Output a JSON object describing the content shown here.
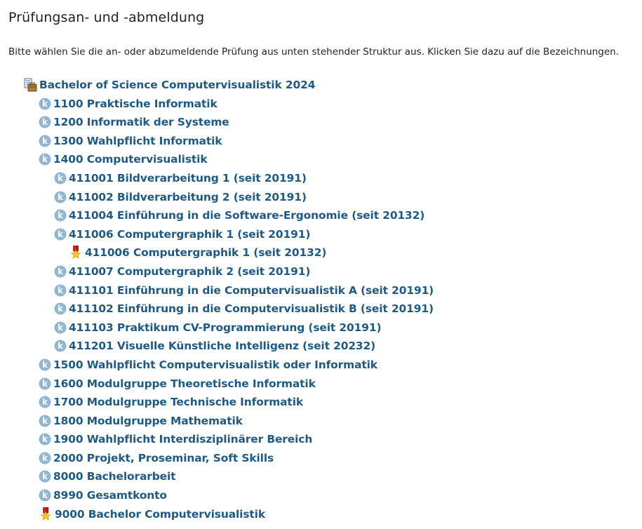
{
  "page": {
    "title": "Prüfungsan- und -abmeldung",
    "instruction": "Bitte wählen Sie die an- oder abzumeldende Prüfung aus unten stehender Struktur aus. Klicken Sie dazu auf die Bezeichnungen."
  },
  "tree": {
    "root": {
      "label": "Bachelor of Science Computervisualistik 2024",
      "icon": "degree-program-icon"
    },
    "level1_a": [
      {
        "label": "1100 Praktische Informatik",
        "icon": "k-module-icon"
      },
      {
        "label": "1200 Informatik der Systeme",
        "icon": "k-module-icon"
      },
      {
        "label": "1300 Wahlpflicht Informatik",
        "icon": "k-module-icon"
      },
      {
        "label": "1400 Computervisualistik",
        "icon": "k-module-icon"
      }
    ],
    "level2": [
      {
        "label": "411001 Bildverarbeitung 1 (seit 20191)",
        "icon": "k-module-icon"
      },
      {
        "label": "411002 Bildverarbeitung 2 (seit 20191)",
        "icon": "k-module-icon"
      },
      {
        "label": "411004 Einführung in die Software-Ergonomie (seit 20132)",
        "icon": "k-module-icon"
      },
      {
        "label": "411006 Computergraphik 1 (seit 20191)",
        "icon": "k-module-icon"
      }
    ],
    "level3": [
      {
        "label": "411006 Computergraphik 1 (seit 20132)",
        "icon": "medal-icon"
      }
    ],
    "level2_b": [
      {
        "label": "411007 Computergraphik 2 (seit 20191)",
        "icon": "k-module-icon"
      },
      {
        "label": "411101 Einführung in die Computervisualistik A (seit 20191)",
        "icon": "k-module-icon"
      },
      {
        "label": "411102 Einführung in die Computervisualistik B (seit 20191)",
        "icon": "k-module-icon"
      },
      {
        "label": "411103 Praktikum CV-Programmierung (seit 20191)",
        "icon": "k-module-icon"
      },
      {
        "label": "411201 Visuelle Künstliche Intelligenz (seit 20232)",
        "icon": "k-module-icon"
      }
    ],
    "level1_b": [
      {
        "label": "1500 Wahlpflicht Computervisualistik oder Informatik",
        "icon": "k-module-icon"
      },
      {
        "label": "1600 Modulgruppe Theoretische Informatik",
        "icon": "k-module-icon"
      },
      {
        "label": "1700 Modulgruppe Technische Informatik",
        "icon": "k-module-icon"
      },
      {
        "label": "1800 Modulgruppe Mathematik",
        "icon": "k-module-icon"
      },
      {
        "label": "1900 Wahlpflicht Interdisziplinärer Bereich",
        "icon": "k-module-icon"
      },
      {
        "label": "2000 Projekt, Proseminar, Soft Skills",
        "icon": "k-module-icon"
      },
      {
        "label": "8000 Bachelorarbeit",
        "icon": "k-module-icon"
      },
      {
        "label": "8990 Gesamtkonto",
        "icon": "k-module-icon"
      }
    ],
    "level1_c": [
      {
        "label": "9000 Bachelor Computervisualistik",
        "icon": "medal-icon"
      }
    ]
  },
  "colors": {
    "link": "#1e5a86",
    "k_icon_bg": "#8fb6d6",
    "medal_red": "#d62020",
    "medal_gold": "#f5c518"
  }
}
